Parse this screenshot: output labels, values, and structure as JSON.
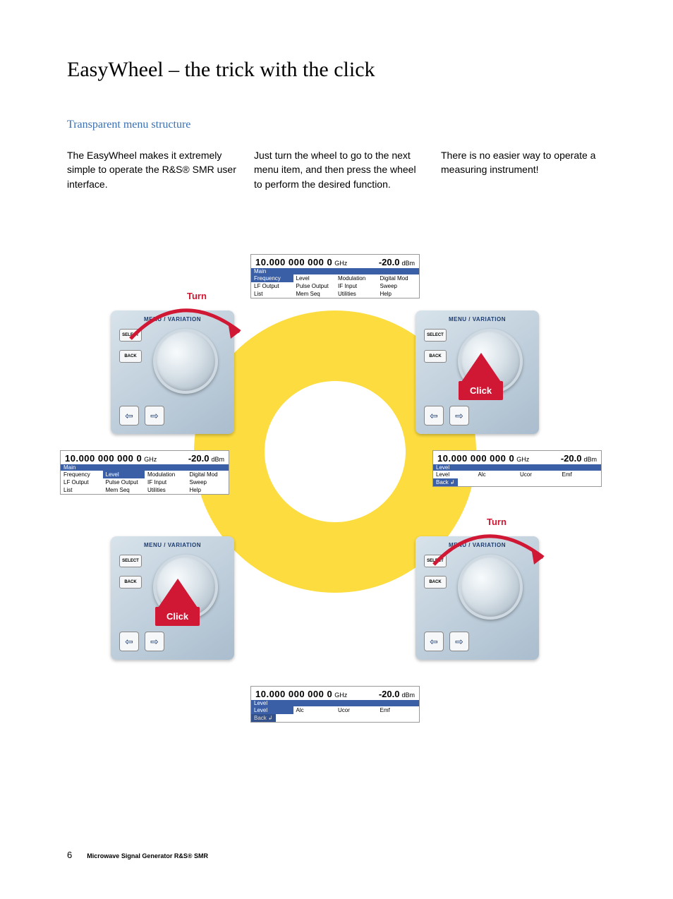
{
  "title": "EasyWheel – the trick with the click",
  "subtitle": "Transparent menu structure",
  "col1": "The EasyWheel makes it extremely simple to operate the R&S® SMR user interface.",
  "col2": "Just turn the wheel to go to the next menu item, and then press the wheel to perform the desired function.",
  "col3": "There is no easier way to operate a measuring instrument!",
  "panel": {
    "header": "MENU / VARIATION",
    "select": "SELECT",
    "back": "BACK",
    "left": "⇦",
    "right": "⇨"
  },
  "actions": {
    "turn": "Turn",
    "click": "Click"
  },
  "screen_common": {
    "freq": "10.000 000 000 0",
    "freq_unit": "GHz",
    "level": "-20.0",
    "level_unit": "dBm"
  },
  "s1": {
    "bar": "Main",
    "rows": [
      [
        "Frequency",
        "Level",
        "Modulation",
        "Digital Mod"
      ],
      [
        "LF Output",
        "Pulse Output",
        "IF Input",
        "Sweep"
      ],
      [
        "List",
        "Mem Seq",
        "Utilities",
        "Help"
      ]
    ],
    "highlight": "Frequency"
  },
  "s2": {
    "bar": "Main",
    "rows": [
      [
        "Frequency",
        "Level",
        "Modulation",
        "Digital Mod"
      ],
      [
        "LF Output",
        "Pulse Output",
        "IF Input",
        "Sweep"
      ],
      [
        "List",
        "Mem Seq",
        "Utilities",
        "Help"
      ]
    ],
    "highlight": "Level"
  },
  "s3": {
    "bar": "Level",
    "row": [
      "Level",
      "Alc",
      "Ucor",
      "Emf"
    ],
    "back": "Back ↲",
    "highlight": "Back ↲"
  },
  "s4": {
    "bar": "Level",
    "row": [
      "Level",
      "Alc",
      "Ucor",
      "Emf"
    ],
    "back": "Back ↲",
    "highlight": "Level"
  },
  "footer": {
    "page": "6",
    "text": "Microwave Signal Generator R&S® SMR"
  }
}
